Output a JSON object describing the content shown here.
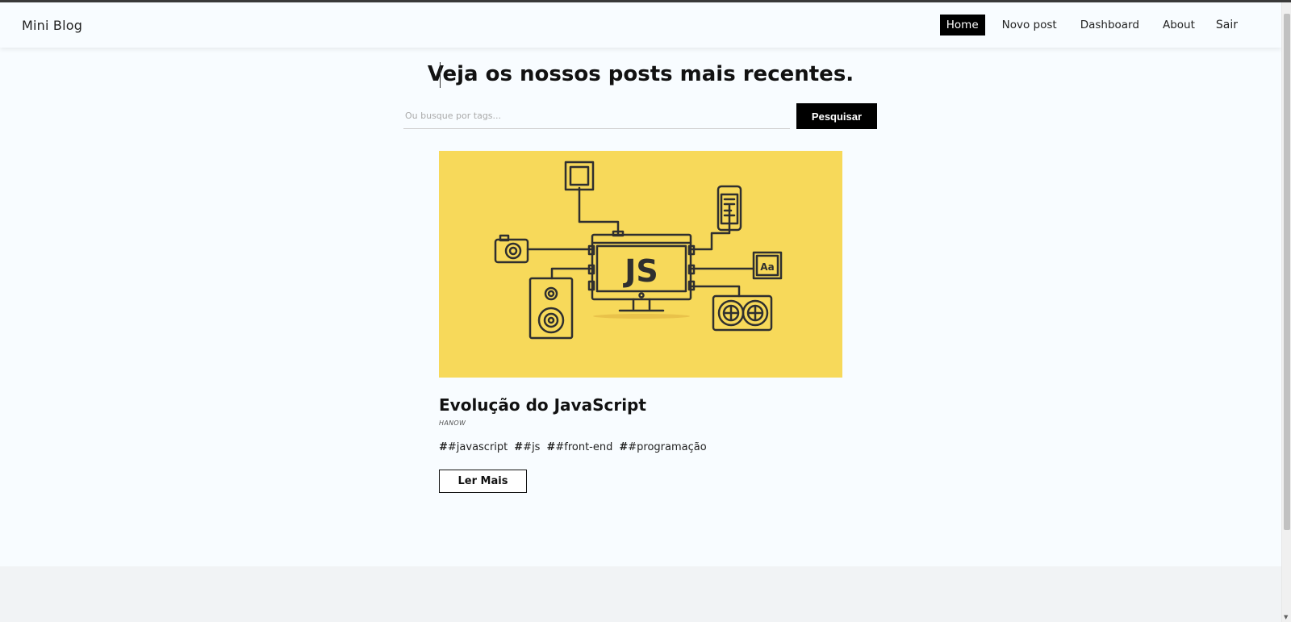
{
  "nav": {
    "brand": "Mini Blog",
    "links": [
      {
        "label": "Home",
        "active": true
      },
      {
        "label": "Novo post",
        "active": false
      },
      {
        "label": "Dashboard",
        "active": false
      },
      {
        "label": "About",
        "active": false
      }
    ],
    "logout_label": "Sair"
  },
  "home": {
    "headline": "Veja os nossos posts mais recentes.",
    "search_placeholder": "Ou busque por tags...",
    "search_button": "Pesquisar"
  },
  "post": {
    "title": "Evolução do JavaScript",
    "author": "HANOW",
    "image_label": "JS",
    "tags": [
      {
        "hash": "#",
        "text": "#javascript"
      },
      {
        "hash": "#",
        "text": "#js"
      },
      {
        "hash": "#",
        "text": "#front-end"
      },
      {
        "hash": "#",
        "text": "#programação"
      }
    ],
    "read_more_label": "Ler Mais"
  },
  "colors": {
    "accent": "#000000",
    "image_bg": "#f7d95a",
    "line_art": "#2f2f2f",
    "page_bg": "#f8fcff",
    "footer_bg": "#f1f3f5"
  },
  "icons": [
    "js-illustration",
    "camera-icon",
    "speaker-icon",
    "phone-icon",
    "font-icon",
    "fan-icon",
    "monitor-icon"
  ]
}
